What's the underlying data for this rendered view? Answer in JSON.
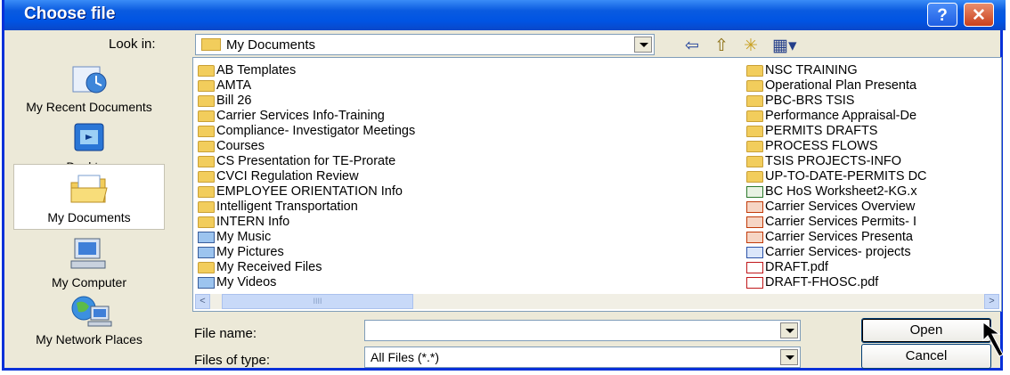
{
  "window": {
    "title": "Choose file",
    "help_label": "?",
    "close_label": "✕"
  },
  "lookin": {
    "label": "Look in:",
    "value": "My Documents"
  },
  "toolbar": {
    "back_glyph": "⇦",
    "up_glyph": "⇧",
    "newfolder_glyph": "✳",
    "views_glyph": "▦▾"
  },
  "sidebar": {
    "items": [
      {
        "label": "My Recent Documents",
        "icon": "recent-documents-icon"
      },
      {
        "label": "Desktop",
        "icon": "desktop-icon"
      },
      {
        "label": "My Documents",
        "icon": "my-documents-icon"
      },
      {
        "label": "My Computer",
        "icon": "my-computer-icon"
      },
      {
        "label": "My Network Places",
        "icon": "network-places-icon"
      }
    ]
  },
  "files": {
    "col1": [
      {
        "name": "AB Templates",
        "type": "folder"
      },
      {
        "name": "AMTA",
        "type": "folder"
      },
      {
        "name": "Bill 26",
        "type": "folder"
      },
      {
        "name": "Carrier Services Info-Training",
        "type": "folder"
      },
      {
        "name": "Compliance- Investigator Meetings",
        "type": "folder"
      },
      {
        "name": "Courses",
        "type": "folder"
      },
      {
        "name": "CS Presentation for TE-Prorate",
        "type": "folder"
      },
      {
        "name": "CVCI Regulation Review",
        "type": "folder"
      },
      {
        "name": "EMPLOYEE ORIENTATION Info",
        "type": "folder"
      },
      {
        "name": "Intelligent Transportation",
        "type": "folder"
      },
      {
        "name": "INTERN Info",
        "type": "folder"
      },
      {
        "name": "My Music",
        "type": "media"
      },
      {
        "name": "My Pictures",
        "type": "media"
      },
      {
        "name": "My Received Files",
        "type": "folder"
      },
      {
        "name": "My Videos",
        "type": "media"
      }
    ],
    "col2": [
      {
        "name": "NSC TRAINING",
        "type": "folder"
      },
      {
        "name": "Operational Plan Presenta",
        "type": "folder"
      },
      {
        "name": "PBC-BRS TSIS",
        "type": "folder"
      },
      {
        "name": "Performance Appraisal-De",
        "type": "folder"
      },
      {
        "name": "PERMITS DRAFTS",
        "type": "folder"
      },
      {
        "name": "PROCESS FLOWS",
        "type": "folder"
      },
      {
        "name": "TSIS PROJECTS-INFO",
        "type": "folder"
      },
      {
        "name": "UP-TO-DATE-PERMITS DC",
        "type": "folder"
      },
      {
        "name": "BC HoS Worksheet2-KG.x",
        "type": "excel"
      },
      {
        "name": "Carrier Services Overview",
        "type": "ppt"
      },
      {
        "name": "Carrier Services Permits- I",
        "type": "ppt"
      },
      {
        "name": "Carrier Services Presenta",
        "type": "ppt"
      },
      {
        "name": "Carrier Services- projects",
        "type": "word"
      },
      {
        "name": "DRAFT.pdf",
        "type": "pdf"
      },
      {
        "name": "DRAFT-FHOSC.pdf",
        "type": "pdf"
      }
    ]
  },
  "scrollbar": {
    "left_arrow": "<",
    "right_arrow": ">",
    "thumb_grip": "IIII"
  },
  "filename": {
    "label": "File name:",
    "value": ""
  },
  "filetype": {
    "label": "Files of type:",
    "value": "All Files (*.*)"
  },
  "buttons": {
    "open": "Open",
    "cancel": "Cancel"
  },
  "colors": {
    "titlebar": "#0054e3",
    "dialog_bg": "#ece9d8",
    "folder": "#f2cd5c"
  }
}
